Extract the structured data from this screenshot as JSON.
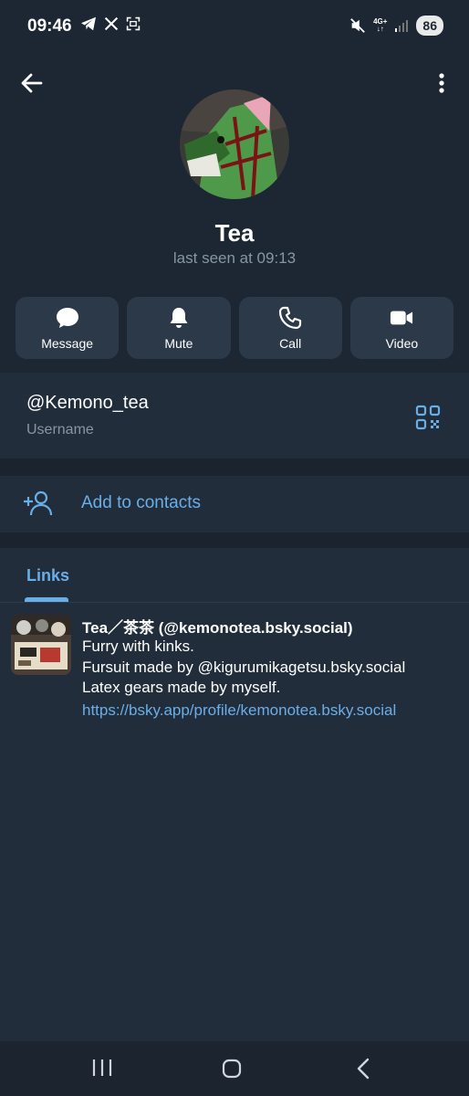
{
  "status_bar": {
    "time": "09:46",
    "network": "4G+",
    "battery": "86"
  },
  "profile": {
    "name": "Tea",
    "last_seen": "last seen at 09:13"
  },
  "actions": [
    {
      "label": "Message",
      "icon": "message-icon"
    },
    {
      "label": "Mute",
      "icon": "bell-icon"
    },
    {
      "label": "Call",
      "icon": "phone-icon"
    },
    {
      "label": "Video",
      "icon": "video-icon"
    }
  ],
  "info": {
    "username": "@Kemono_tea",
    "username_label": "Username"
  },
  "contacts": {
    "add_label": "Add to contacts"
  },
  "links": {
    "tab_label": "Links",
    "item": {
      "title": "Tea／茶茶 (@kemonotea.bsky.social)",
      "description_lines": [
        "Furry with kinks.",
        "Fursuit made by @kigurumikagetsu.bsky.social",
        "Latex gears made by myself."
      ],
      "url": "https://bsky.app/profile/kemonotea.bsky.social"
    }
  },
  "colors": {
    "background": "#1d2733",
    "card": "#212d3b",
    "button": "#2c3949",
    "accent": "#6aaee8",
    "muted_text": "#8796a5"
  }
}
